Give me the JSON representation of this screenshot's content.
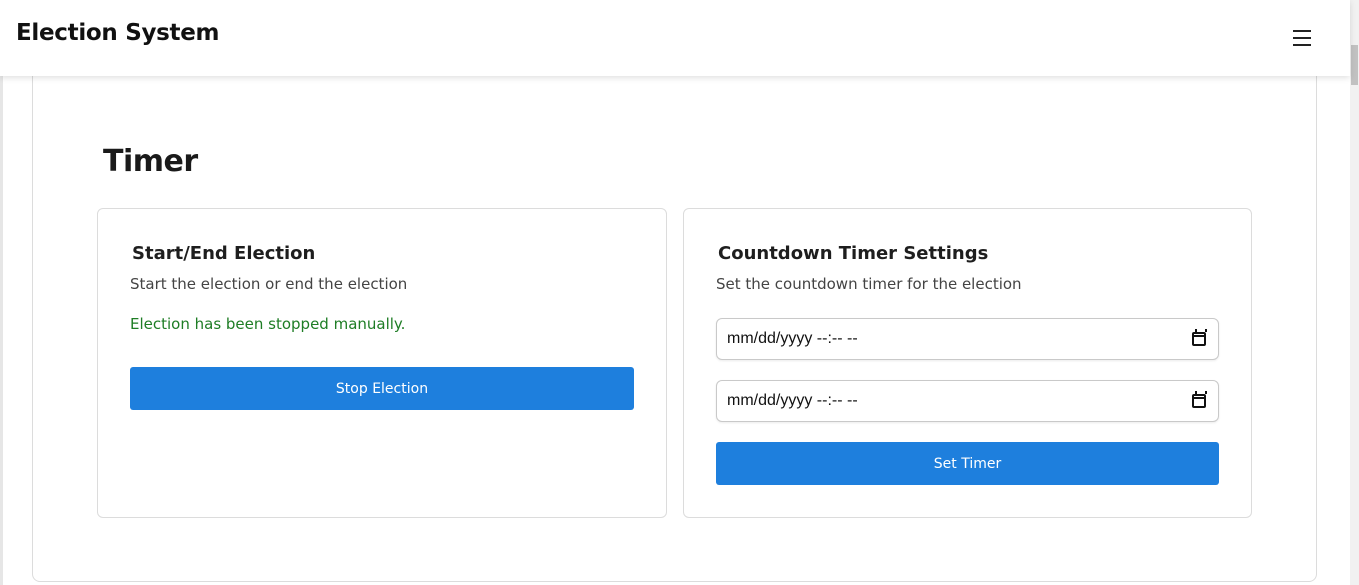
{
  "header": {
    "title": "Election System",
    "menu_icon": "hamburger-menu-icon"
  },
  "main": {
    "section_title": "Timer"
  },
  "start_end_card": {
    "title": "Start/End Election",
    "description": "Start the election or end the election",
    "status": "Election has been stopped manually.",
    "status_color": "#1e7d25",
    "button_label": "Stop Election"
  },
  "countdown_card": {
    "title": "Countdown Timer Settings",
    "description": "Set the countdown timer for the election",
    "start_datetime": {
      "placeholder": "mm/dd/yyyy --:-- --",
      "icon": "calendar-icon"
    },
    "end_datetime": {
      "placeholder": "mm/dd/yyyy --:-- --",
      "icon": "calendar-icon"
    },
    "button_label": "Set Timer"
  },
  "colors": {
    "primary_button": "#1e7fdd",
    "success_text": "#1e7d25"
  }
}
